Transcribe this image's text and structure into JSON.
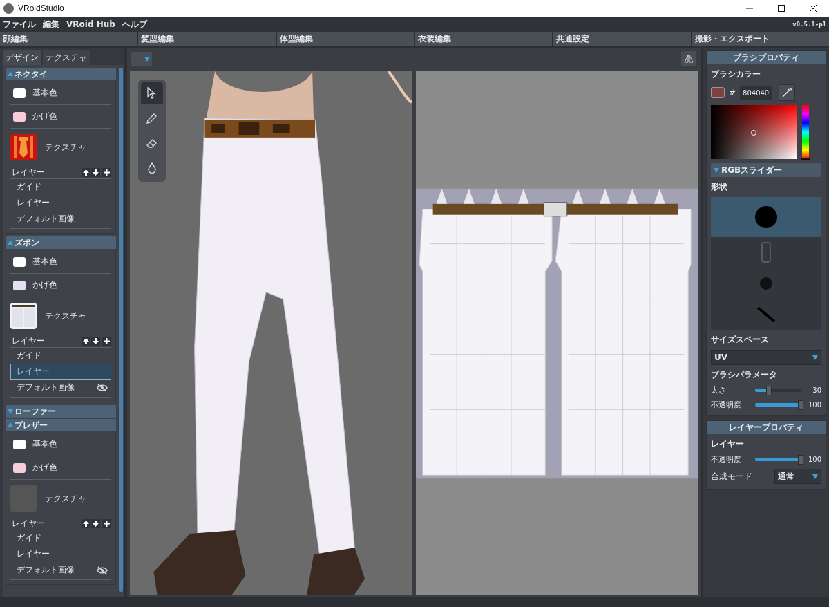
{
  "window": {
    "title": "VRoidStudio"
  },
  "menu": [
    "ファイル",
    "編集",
    "VRoid Hub",
    "ヘルプ"
  ],
  "version": "v0.5.1-p1",
  "mode_tabs": [
    "顔編集",
    "髪型編集",
    "体型編集",
    "衣装編集",
    "共通設定",
    "撮影・エクスポート"
  ],
  "sub_tabs": [
    {
      "label": "デザイン",
      "selected": false
    },
    {
      "label": "テクスチャ",
      "selected": true
    }
  ],
  "sections": [
    {
      "title": "ネクタイ",
      "expanded": true,
      "colors": [
        {
          "label": "基本色",
          "color": "#ffffff"
        },
        {
          "label": "かげ色",
          "color": "#f7cddb"
        }
      ],
      "texture": {
        "label": "テクスチャ",
        "kind": "tie"
      },
      "layer_label": "レイヤー",
      "layers": [
        {
          "label": "ガイド",
          "selected": false,
          "hidden": false
        },
        {
          "label": "レイヤー",
          "selected": false,
          "hidden": false
        },
        {
          "label": "デフォルト画像",
          "selected": false,
          "hidden": false
        }
      ]
    },
    {
      "title": "ズボン",
      "expanded": true,
      "colors": [
        {
          "label": "基本色",
          "color": "#ffffff"
        },
        {
          "label": "かげ色",
          "color": "#e6e0f4"
        }
      ],
      "texture": {
        "label": "テクスチャ",
        "kind": "pants"
      },
      "layer_label": "レイヤー",
      "layers": [
        {
          "label": "ガイド",
          "selected": false,
          "hidden": false
        },
        {
          "label": "レイヤー",
          "selected": true,
          "hidden": false
        },
        {
          "label": "デフォルト画像",
          "selected": false,
          "hidden": true
        }
      ]
    },
    {
      "title": "ローファー",
      "expanded": false
    },
    {
      "title": "ブレザー",
      "expanded": true,
      "colors": [
        {
          "label": "基本色",
          "color": "#ffffff"
        },
        {
          "label": "かげ色",
          "color": "#f7cddb"
        }
      ],
      "texture": {
        "label": "テクスチャ",
        "kind": "empty"
      },
      "layer_label": "レイヤー",
      "layers": [
        {
          "label": "ガイド",
          "selected": false,
          "hidden": false
        },
        {
          "label": "レイヤー",
          "selected": false,
          "hidden": false
        },
        {
          "label": "デフォルト画像",
          "selected": false,
          "hidden": true
        }
      ]
    }
  ],
  "tools": [
    {
      "kind": "select",
      "selected": true
    },
    {
      "kind": "pen",
      "selected": false
    },
    {
      "kind": "eraser",
      "selected": false
    },
    {
      "kind": "fill",
      "selected": false
    }
  ],
  "brush_panel": {
    "title": "ブラシプロパティ",
    "color_label": "ブラシカラー",
    "hash": "#",
    "hex": "804040",
    "color": "#804040",
    "hue_slider": {
      "level": 0
    },
    "rgb_toggle": "RGBスライダー",
    "shape_label": "形状",
    "shapes": [
      {
        "kind": "round",
        "selected": true
      },
      {
        "kind": "texture",
        "selected": false
      },
      {
        "kind": "soft",
        "selected": false
      },
      {
        "kind": "line",
        "selected": false
      }
    ],
    "size_space_label": "サイズスペース",
    "size_space": "UV",
    "params_label": "ブラシパラメータ",
    "sliders": [
      {
        "label": "太さ",
        "level": 0.3,
        "reading": "30"
      },
      {
        "label": "不透明度",
        "level": 1,
        "reading": "100"
      }
    ]
  },
  "layer_panel": {
    "title": "レイヤープロパティ",
    "layer_label": "レイヤー",
    "sliders": [
      {
        "label": "不透明度",
        "level": 1,
        "reading": "100"
      }
    ],
    "blend_label": "合成モード",
    "blend_mode": "通常"
  }
}
